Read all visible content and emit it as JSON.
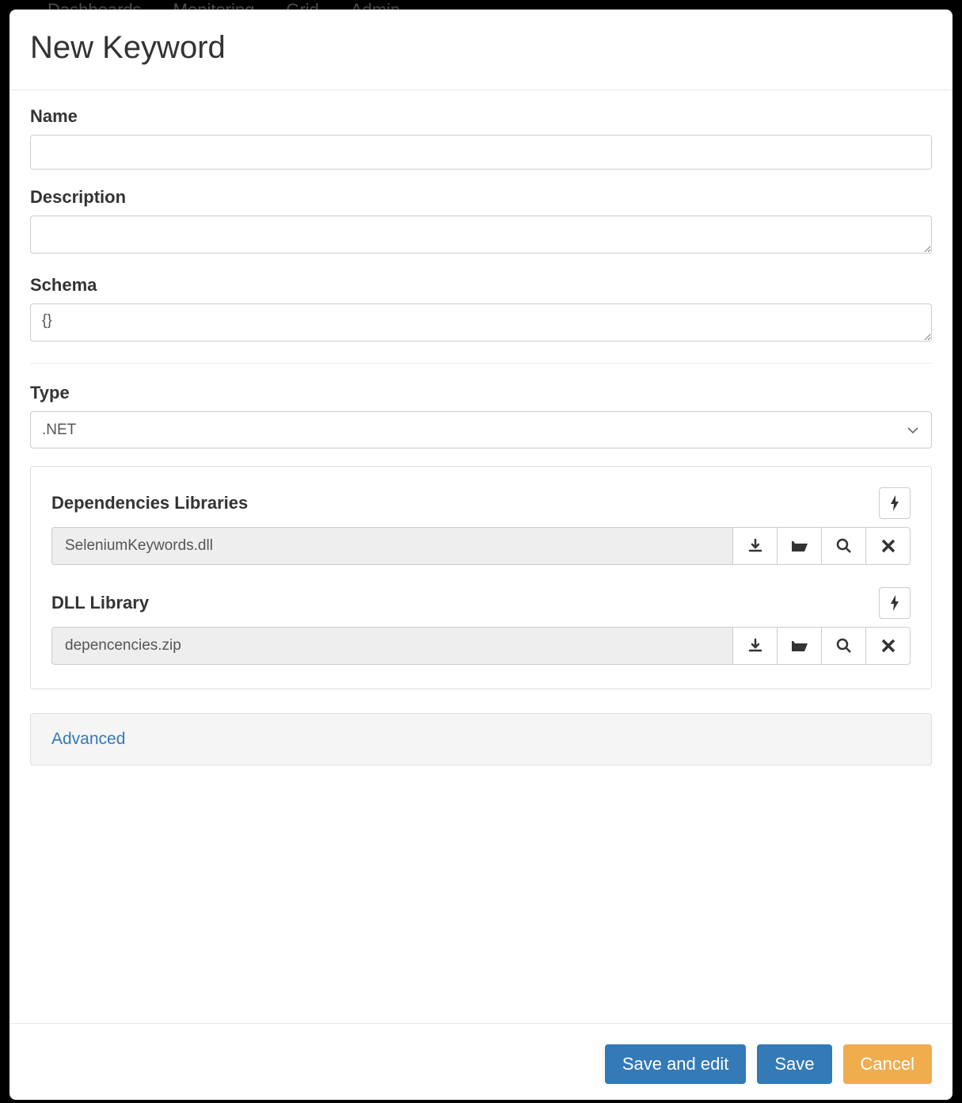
{
  "background_nav": {
    "items": [
      "Dashboards",
      "Monitoring",
      "Grid",
      "Admin"
    ]
  },
  "modal": {
    "title": "New Keyword"
  },
  "form": {
    "name": {
      "label": "Name",
      "value": ""
    },
    "description": {
      "label": "Description",
      "value": ""
    },
    "schema": {
      "label": "Schema",
      "value": "{}"
    },
    "type": {
      "label": "Type",
      "value": ".NET"
    }
  },
  "libraries": {
    "dependencies": {
      "title": "Dependencies Libraries",
      "file": "SeleniumKeywords.dll"
    },
    "dll": {
      "title": "DLL Library",
      "file": "depencencies.zip"
    }
  },
  "advanced": {
    "label": "Advanced"
  },
  "footer": {
    "save_and_edit": "Save and edit",
    "save": "Save",
    "cancel": "Cancel"
  }
}
